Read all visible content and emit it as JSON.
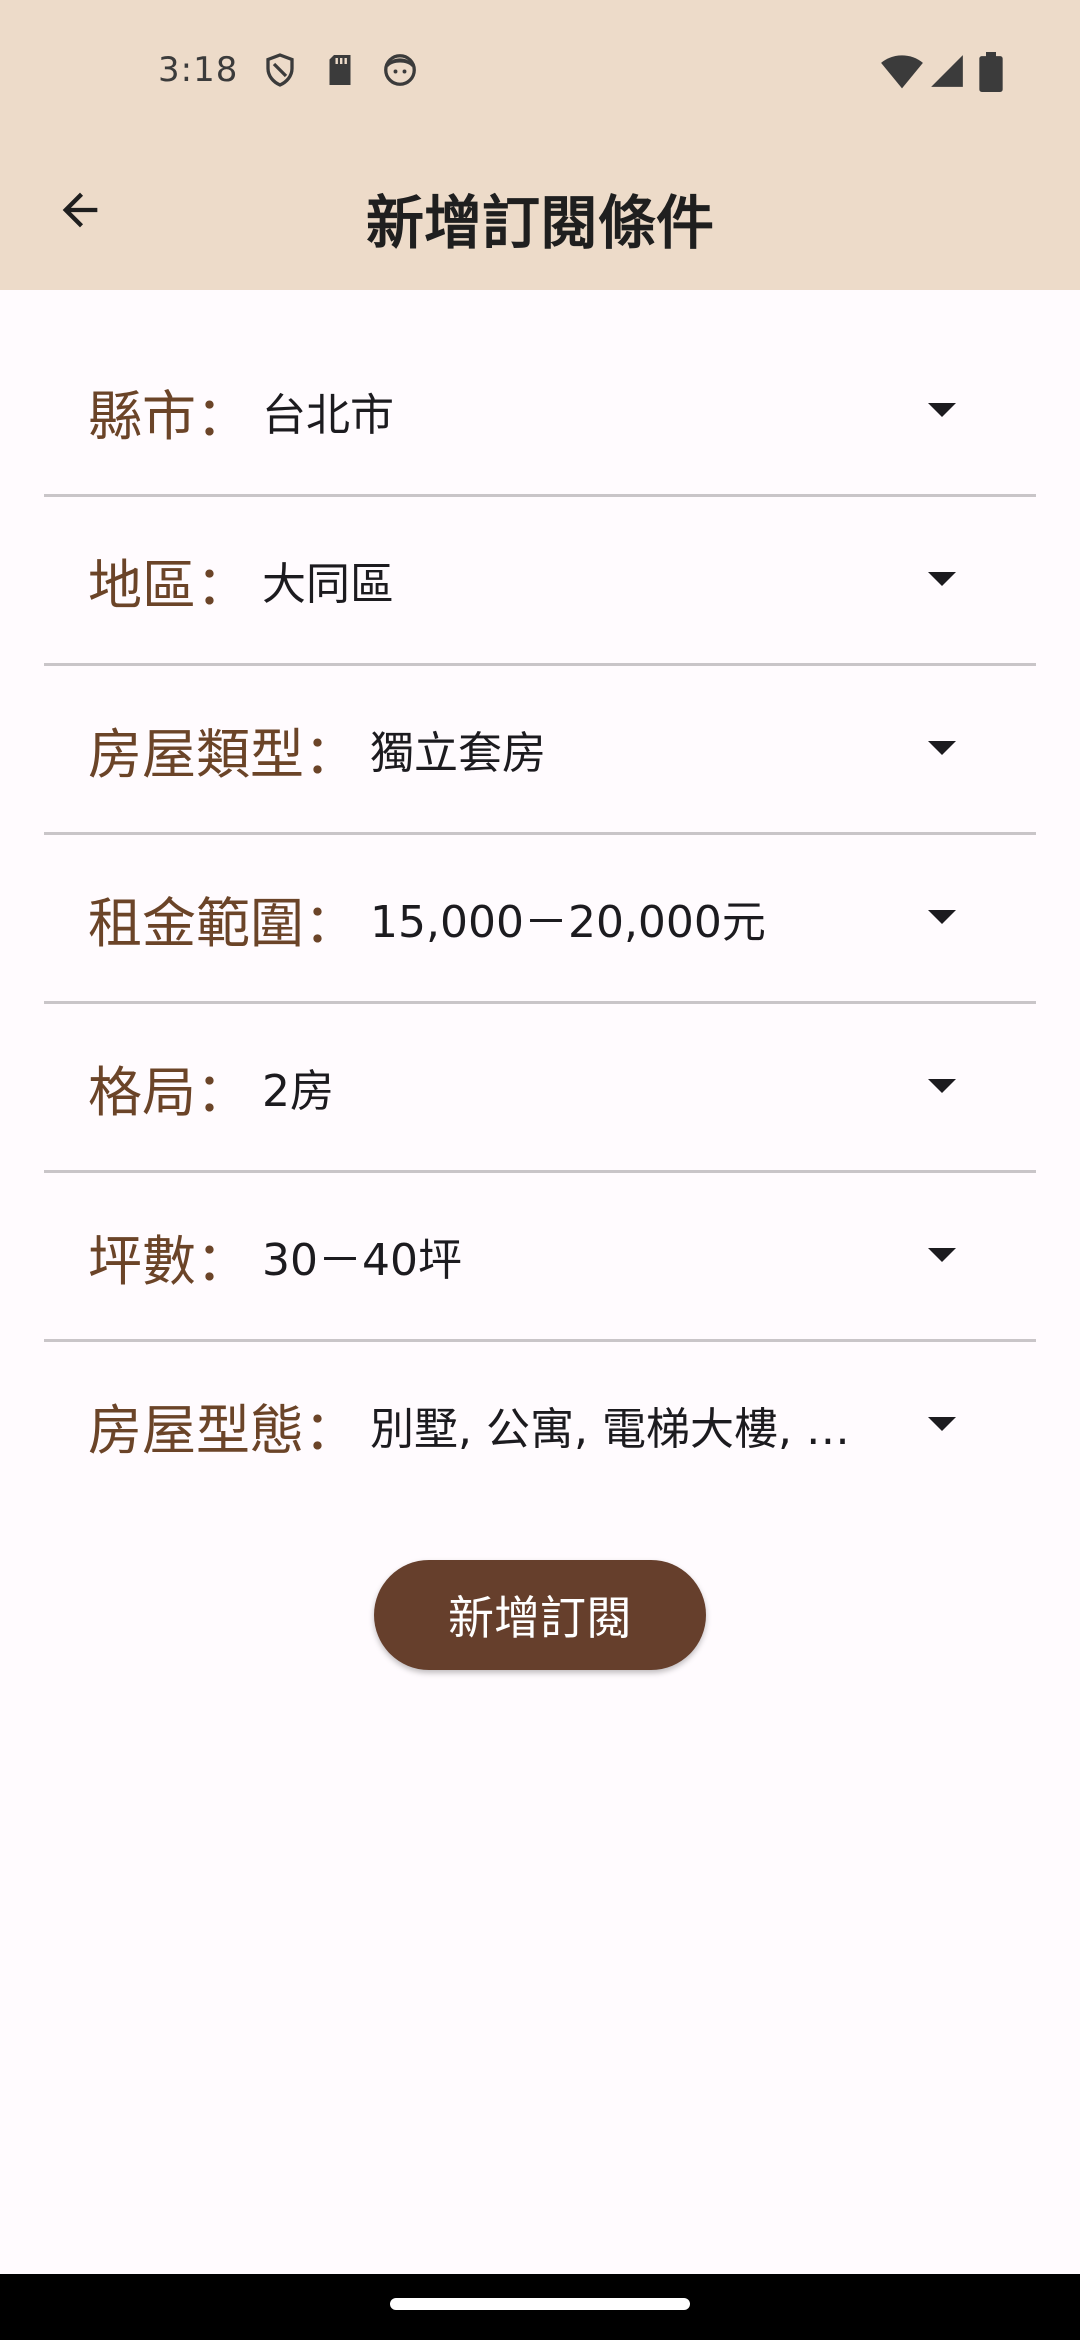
{
  "status_bar": {
    "time": "3:18",
    "icons_left": [
      "shield-icon",
      "sd-card-icon",
      "face-icon"
    ],
    "icons_right": [
      "wifi-icon",
      "signal-icon",
      "battery-icon"
    ]
  },
  "app_bar": {
    "title": "新增訂閱條件",
    "back_icon": "arrow-back-icon"
  },
  "form": {
    "rows": [
      {
        "label": "縣市：",
        "value": "台北市"
      },
      {
        "label": "地區：",
        "value": "大同區"
      },
      {
        "label": "房屋類型：",
        "value": "獨立套房"
      },
      {
        "label": "租金範圍：",
        "value": "15,000－20,000元"
      },
      {
        "label": "格局：",
        "value": "2房"
      },
      {
        "label": "坪數：",
        "value": "30－40坪"
      },
      {
        "label": "房屋型態：",
        "value": "別墅, 公寓, 電梯大樓, …"
      }
    ]
  },
  "submit_button": {
    "label": "新增訂閱"
  },
  "colors": {
    "app_bar_bg": "#eddbc9",
    "label_color": "#6b4428",
    "button_bg": "#663f2c"
  }
}
